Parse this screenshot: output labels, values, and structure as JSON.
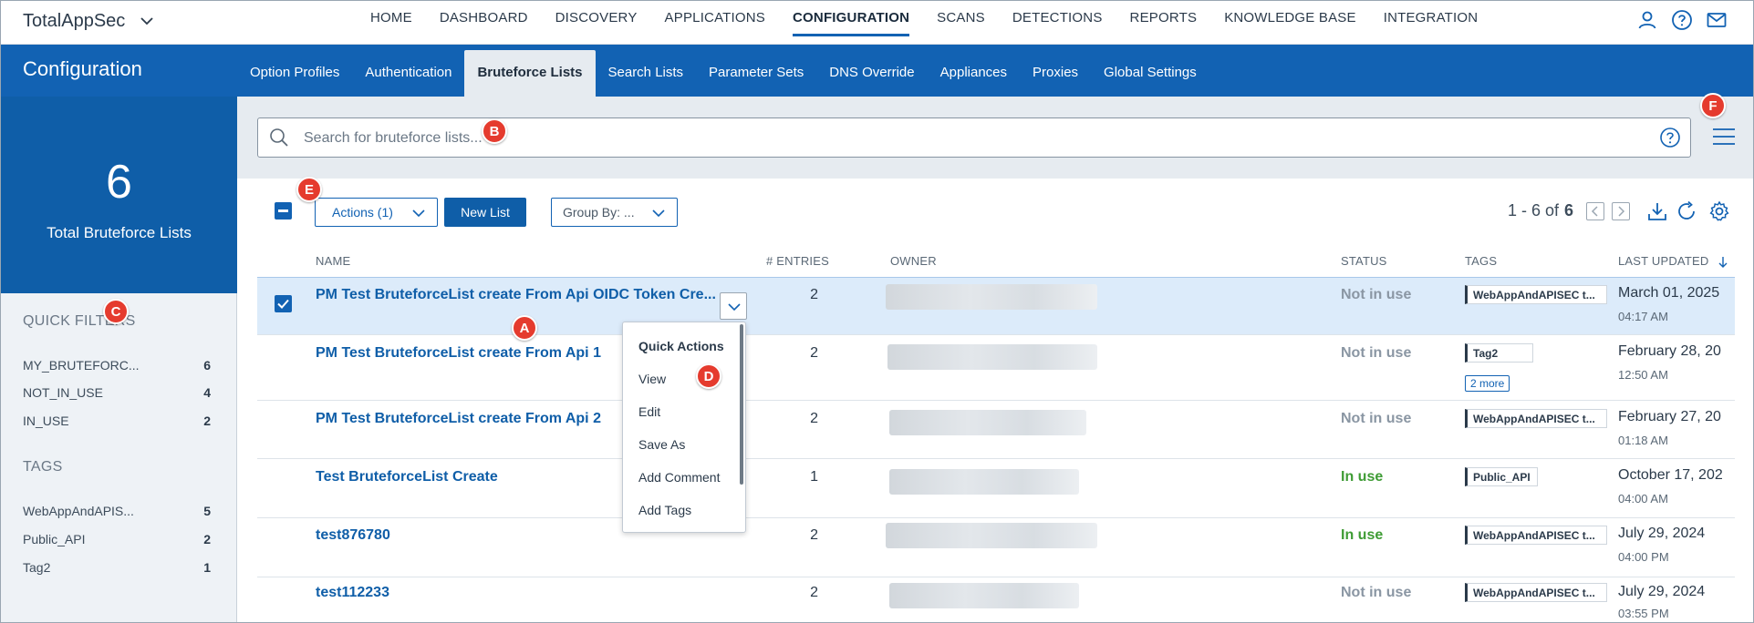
{
  "app": {
    "name": "TotalAppSec"
  },
  "topnav": {
    "items": [
      "HOME",
      "DASHBOARD",
      "DISCOVERY",
      "APPLICATIONS",
      "CONFIGURATION",
      "SCANS",
      "DETECTIONS",
      "REPORTS",
      "KNOWLEDGE BASE",
      "INTEGRATION"
    ],
    "active": "CONFIGURATION",
    "icons": [
      "user-icon",
      "help-icon",
      "mail-icon"
    ]
  },
  "header": {
    "title": "Configuration",
    "tabs": [
      "Option Profiles",
      "Authentication",
      "Bruteforce Lists",
      "Search Lists",
      "Parameter Sets",
      "DNS Override",
      "Appliances",
      "Proxies",
      "Global Settings"
    ],
    "active_tab": "Bruteforce Lists"
  },
  "summary": {
    "count": "6",
    "label": "Total Bruteforce Lists"
  },
  "quick_filters": {
    "title": "QUICK FILTERS",
    "items": [
      {
        "label": "MY_BRUTEFORC...",
        "count": "6"
      },
      {
        "label": "NOT_IN_USE",
        "count": "4"
      },
      {
        "label": "IN_USE",
        "count": "2"
      }
    ]
  },
  "tags_filter": {
    "title": "TAGS",
    "items": [
      {
        "label": "WebAppAndAPIS...",
        "count": "5"
      },
      {
        "label": "Public_API",
        "count": "2"
      },
      {
        "label": "Tag2",
        "count": "1"
      }
    ]
  },
  "search": {
    "placeholder": "Search for bruteforce lists...",
    "value": ""
  },
  "toolbar": {
    "actions_label": "Actions (1)",
    "new_label": "New List",
    "group_by_label": "Group By: ..."
  },
  "pager": {
    "range": "1 - 6 of",
    "total": "6"
  },
  "table": {
    "headers": {
      "name": "NAME",
      "entries": "# ENTRIES",
      "owner": "OWNER",
      "status": "STATUS",
      "tags": "TAGS",
      "updated": "LAST UPDATED"
    },
    "rows": [
      {
        "name": "PM Test BruteforceList create From Api OIDC Token Cre...",
        "entries": "2",
        "status": "Not in use",
        "tag": "WebAppAndAPISEC t...",
        "more": "",
        "date": "March 01, 2025",
        "time": "04:17 AM",
        "selected": true
      },
      {
        "name": "PM Test BruteforceList create From Api 1",
        "entries": "2",
        "status": "Not in use",
        "tag": "Tag2",
        "more": "2 more",
        "date": "February 28, 20",
        "time": "12:50 AM",
        "selected": false
      },
      {
        "name": "PM Test BruteforceList create From Api 2",
        "entries": "2",
        "status": "Not in use",
        "tag": "WebAppAndAPISEC t...",
        "more": "",
        "date": "February 27, 20",
        "time": "01:18 AM",
        "selected": false
      },
      {
        "name": "Test BruteforceList Create",
        "entries": "1",
        "status": "In use",
        "tag": "Public_API",
        "more": "",
        "date": "October 17, 202",
        "time": "04:00 AM",
        "selected": false
      },
      {
        "name": "test876780",
        "entries": "2",
        "status": "In use",
        "tag": "WebAppAndAPISEC t...",
        "more": "",
        "date": "July 29, 2024",
        "time": "04:00 PM",
        "selected": false
      },
      {
        "name": "test112233",
        "entries": "2",
        "status": "Not in use",
        "tag": "WebAppAndAPISEC t...",
        "more": "",
        "date": "July 29, 2024",
        "time": "03:55 PM",
        "selected": false
      }
    ]
  },
  "quick_actions": {
    "title": "Quick Actions",
    "items": [
      "View",
      "Edit",
      "Save As",
      "Add Comment",
      "Add Tags"
    ]
  },
  "markers": [
    "A",
    "B",
    "C",
    "D",
    "E",
    "F"
  ],
  "colors": {
    "brand_blue": "#1262b3",
    "marker_red": "#e53b2e",
    "status_green": "#3f9c35",
    "status_gray": "#8a96a3"
  }
}
